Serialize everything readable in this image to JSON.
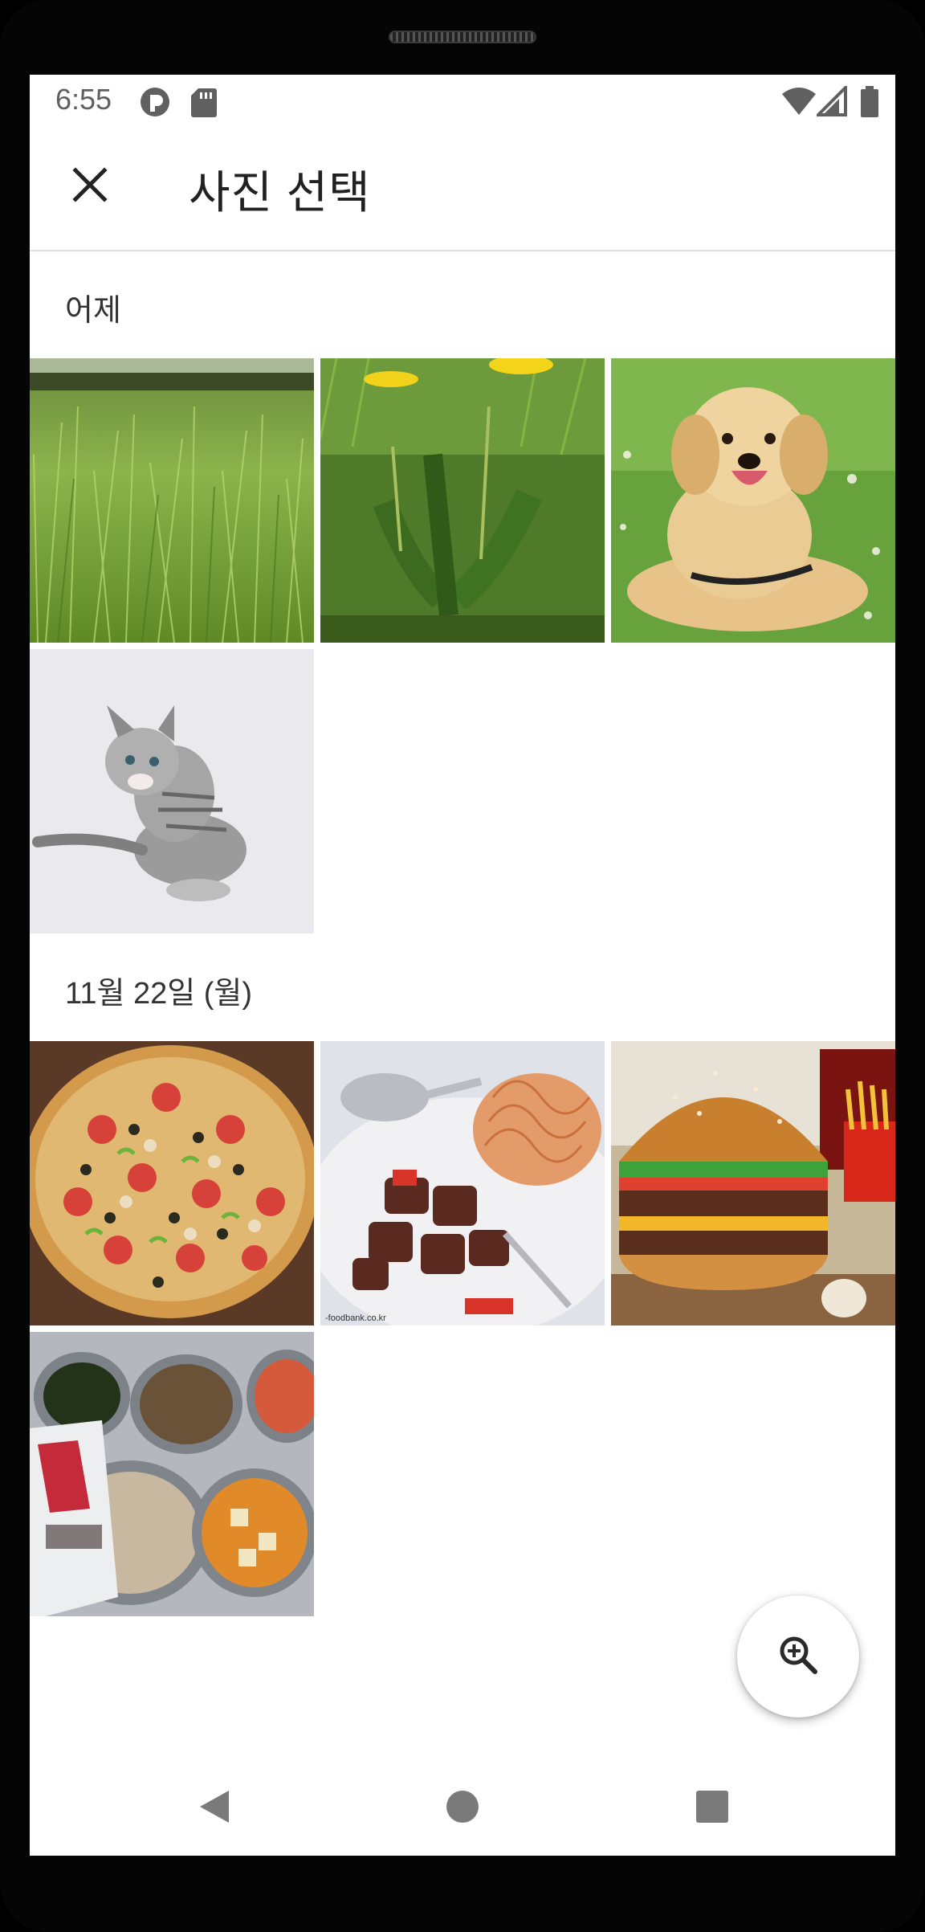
{
  "status_bar": {
    "time": "6:55",
    "left_icons": [
      "notification-app-icon",
      "sd-card-icon"
    ],
    "right_icons": [
      "wifi-icon",
      "cell-signal-icon",
      "battery-icon"
    ]
  },
  "app_bar": {
    "title": "사진 선택",
    "close_icon": "close-icon"
  },
  "sections": [
    {
      "header": "어제",
      "photos": [
        {
          "name": "photo-grass"
        },
        {
          "name": "photo-dandelion"
        },
        {
          "name": "photo-golden-retriever"
        },
        {
          "name": "photo-kitten"
        }
      ]
    },
    {
      "header": "11월 22일 (월)",
      "photos": [
        {
          "name": "photo-pizza"
        },
        {
          "name": "photo-steak-pasta",
          "watermark": "-foodbank.co.kr"
        },
        {
          "name": "photo-burger"
        },
        {
          "name": "photo-school-lunch-tray"
        }
      ]
    }
  ],
  "fab": {
    "icon": "zoom-in-icon"
  },
  "nav_bar": {
    "icons": [
      "back-icon",
      "home-icon",
      "recents-icon"
    ]
  },
  "colors": {
    "screen_bg": "#ffffff",
    "device_frame": "#050505",
    "title_text": "#212121",
    "status_icons": "#5f5f5f",
    "nav_icons": "#7a7a7a"
  }
}
